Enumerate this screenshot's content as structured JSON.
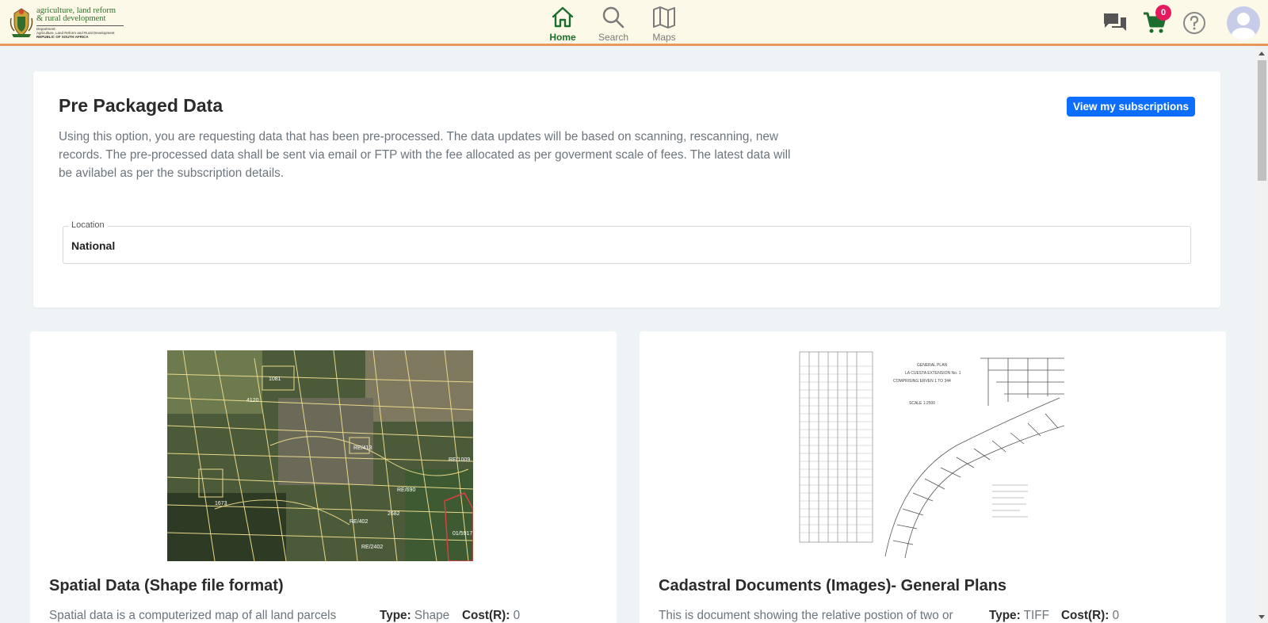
{
  "header": {
    "logo": {
      "line1": "agriculture, land reform",
      "line2": "& rural development",
      "small1": "Department:",
      "small2": "Agriculture, Land Reform and Rural Development",
      "small3": "REPUBLIC OF SOUTH AFRICA"
    },
    "nav": [
      {
        "label": "Home",
        "icon": "home-icon",
        "active": true
      },
      {
        "label": "Search",
        "icon": "search-icon",
        "active": false
      },
      {
        "label": "Maps",
        "icon": "map-icon",
        "active": false
      }
    ],
    "cart_count": "0",
    "colors": {
      "background": "#fdf9e8",
      "accent_border": "#e8955a",
      "active_nav": "#1c6e2e",
      "badge": "#e5195e"
    }
  },
  "info": {
    "title": "Pre Packaged Data",
    "subscriptions_button": "View my subscriptions",
    "description": "Using this option, you are requesting data that has been pre-processed. The data updates will be based on scanning, rescanning, new records. The pre-processed data shall be sent via email or FTP with the fee allocated as per goverment scale of fees. The latest data will be avilabel as per the subscription details.",
    "location_label": "Location",
    "location_value": "National"
  },
  "products": [
    {
      "title": "Spatial Data (Shape file format)",
      "description": "Spatial data is a computerized map of all land parcels",
      "type_label": "Type:",
      "type_value": "Shape",
      "cost_label": "Cost(R):",
      "cost_value": "0"
    },
    {
      "title": "Cadastral Documents (Images)- General Plans",
      "description": "This is document showing the relative postion of two or",
      "type_label": "Type:",
      "type_value": "TIFF",
      "cost_label": "Cost(R):",
      "cost_value": "0"
    }
  ]
}
